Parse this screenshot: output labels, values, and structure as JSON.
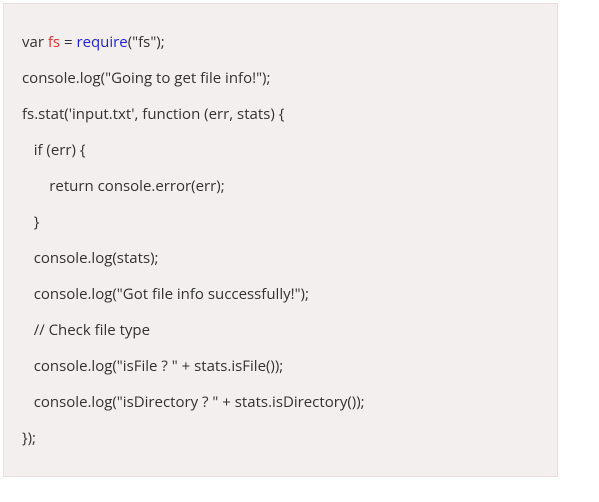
{
  "code": {
    "lines": [
      {
        "indent": "",
        "segments": [
          {
            "t": "var ",
            "c": "keyword"
          },
          {
            "t": "fs",
            "c": "varname"
          },
          {
            "t": " = ",
            "c": "plain"
          },
          {
            "t": "require",
            "c": "func"
          },
          {
            "t": "(\"fs\");",
            "c": "plain"
          }
        ]
      },
      {
        "indent": "",
        "segments": [
          {
            "t": "console.log(\"Going to get file info!\");",
            "c": "plain"
          }
        ]
      },
      {
        "indent": "",
        "segments": [
          {
            "t": "fs.stat('input.txt', function (err, stats) {",
            "c": "plain"
          }
        ]
      },
      {
        "indent": "   ",
        "segments": [
          {
            "t": "if (err) {",
            "c": "plain"
          }
        ]
      },
      {
        "indent": "       ",
        "segments": [
          {
            "t": "return console.error(err);",
            "c": "plain"
          }
        ]
      },
      {
        "indent": "   ",
        "segments": [
          {
            "t": "}",
            "c": "plain"
          }
        ]
      },
      {
        "indent": "   ",
        "segments": [
          {
            "t": "console.log(stats);",
            "c": "plain"
          }
        ]
      },
      {
        "indent": "   ",
        "segments": [
          {
            "t": "console.log(\"Got file info successfully!\");",
            "c": "plain"
          }
        ]
      },
      {
        "indent": "   ",
        "segments": [
          {
            "t": "// Check file type",
            "c": "plain"
          }
        ]
      },
      {
        "indent": "   ",
        "segments": [
          {
            "t": "console.log(\"isFile ? \" + stats.isFile());",
            "c": "plain"
          }
        ]
      },
      {
        "indent": "   ",
        "segments": [
          {
            "t": "console.log(\"isDirectory ? \" + stats.isDirectory());",
            "c": "plain"
          }
        ]
      },
      {
        "indent": "",
        "segments": [
          {
            "t": "});",
            "c": "plain"
          }
        ]
      }
    ]
  }
}
